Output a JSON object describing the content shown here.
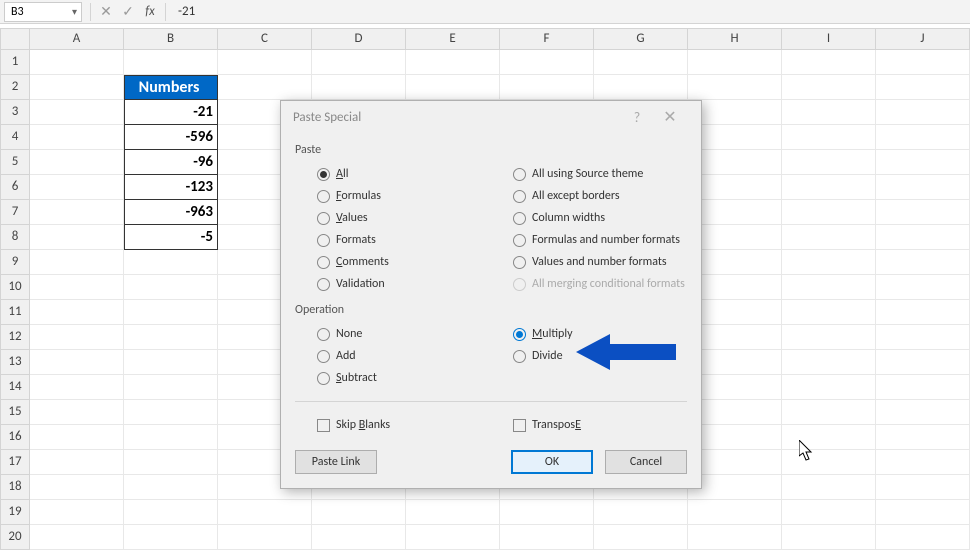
{
  "name_box": "B3",
  "formula_btn_x": "✕",
  "formula_btn_check": "✓",
  "formula_fx": "fx",
  "formula_value": "-21",
  "columns": [
    "A",
    "B",
    "C",
    "D",
    "E",
    "F",
    "G",
    "H",
    "I",
    "J"
  ],
  "rows": [
    "1",
    "2",
    "3",
    "4",
    "5",
    "6",
    "7",
    "8",
    "9",
    "10",
    "11",
    "12",
    "13",
    "14",
    "15",
    "16",
    "17",
    "18",
    "19",
    "20"
  ],
  "header_cell": "Numbers",
  "data_cells": [
    "-21",
    "-596",
    "-96",
    "-123",
    "-963",
    "-5"
  ],
  "dialog": {
    "title": "Paste Special",
    "help": "?",
    "close": "✕",
    "paste_label": "Paste",
    "paste_left": [
      {
        "label": "All",
        "u": "A",
        "checked": true
      },
      {
        "label": "Formulas",
        "u": "F"
      },
      {
        "label": "Values",
        "u": "V"
      },
      {
        "label": "Formats",
        "u": "T"
      },
      {
        "label": "Comments",
        "u": "C"
      },
      {
        "label": "Validation",
        "u": "N"
      }
    ],
    "paste_right": [
      {
        "label": "All using Source theme",
        "u": "H"
      },
      {
        "label": "All except borders",
        "u": "X"
      },
      {
        "label": "Column widths",
        "u": "W"
      },
      {
        "label": "Formulas and number formats",
        "u": "R"
      },
      {
        "label": "Values and number formats",
        "u": "U"
      },
      {
        "label": "All merging conditional formats",
        "disabled": true
      }
    ],
    "operation_label": "Operation",
    "op_left": [
      {
        "label": "None",
        "u": "O"
      },
      {
        "label": "Add",
        "u": "D"
      },
      {
        "label": "Subtract",
        "u": "S"
      }
    ],
    "op_right": [
      {
        "label": "Multiply",
        "u": "M",
        "checked": true,
        "blue": true
      },
      {
        "label": "Divide",
        "u": "I"
      }
    ],
    "skip_blanks": "Skip blanks",
    "skip_u": "B",
    "transpose": "Transpose",
    "transpose_u": "E",
    "paste_link": "Paste Link",
    "ok": "OK",
    "cancel": "Cancel"
  }
}
